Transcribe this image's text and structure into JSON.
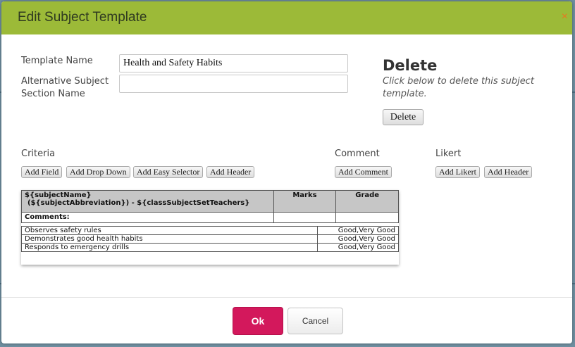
{
  "dialog": {
    "title": "Edit Subject Template",
    "close_icon": "close-icon",
    "close_glyph": "×"
  },
  "form": {
    "template_name_label": "Template Name",
    "template_name_value": "Health and Safety Habits",
    "alt_name_label": "Alternative Subject Section Name",
    "alt_name_value": ""
  },
  "delete_section": {
    "title": "Delete",
    "description": "Click below to delete this subject template.",
    "button_label": "Delete"
  },
  "criteria": {
    "label": "Criteria",
    "buttons": [
      "Add Field",
      "Add Drop Down",
      "Add Easy Selector",
      "Add Header"
    ]
  },
  "comment": {
    "label": "Comment",
    "buttons": [
      "Add Comment"
    ]
  },
  "likert": {
    "label": "Likert",
    "buttons": [
      "Add Likert",
      "Add Header"
    ]
  },
  "preview": {
    "subject_line1": "${subjectName}",
    "subject_line2": "(${subjectAbbreviation}) - ${classSubjectSetTeachers}",
    "marks_header": "Marks",
    "grade_header": "Grade",
    "comments_label": "Comments:",
    "rows": [
      {
        "criterion": "Observes safety rules",
        "value": "Good,Very Good"
      },
      {
        "criterion": "Demonstrates good health habits",
        "value": "Good,Very Good"
      },
      {
        "criterion": "Responds to emergency drills",
        "value": "Good,Very Good"
      }
    ]
  },
  "footer": {
    "ok_label": "Ok",
    "cancel_label": "Cancel"
  },
  "colors": {
    "header_bg": "#9cba38",
    "close_icon": "#e87722",
    "ok_button": "#d3185c",
    "table_header_bg": "#c6c6c6"
  }
}
